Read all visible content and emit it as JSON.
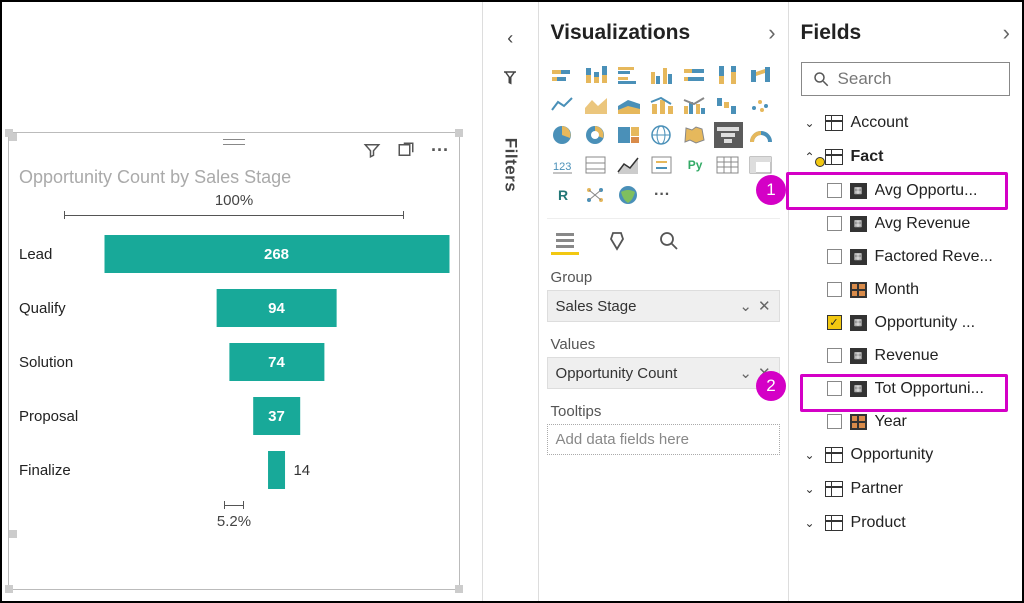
{
  "panes": {
    "visualizations_title": "Visualizations",
    "fields_title": "Fields",
    "filters_title": "Filters"
  },
  "search": {
    "placeholder": "Search"
  },
  "chart_data": {
    "type": "bar",
    "title": "Opportunity Count by Sales Stage",
    "top_pct": "100%",
    "bottom_pct": "5.2%",
    "categories": [
      "Lead",
      "Qualify",
      "Solution",
      "Proposal",
      "Finalize"
    ],
    "values": [
      268,
      94,
      74,
      37,
      14
    ]
  },
  "wells": {
    "group_label": "Group",
    "group_value": "Sales Stage",
    "values_label": "Values",
    "values_value": "Opportunity Count",
    "tooltips_label": "Tooltips",
    "tooltips_placeholder": "Add data fields here"
  },
  "viz_tiles": {
    "py": "Py",
    "r": "R",
    "more": "···"
  },
  "tree": {
    "account": "Account",
    "fact": "Fact",
    "fields": {
      "avg_opp": "Avg Opportu...",
      "avg_rev": "Avg Revenue",
      "fact_rev": "Factored Reve...",
      "month": "Month",
      "opp_count": "Opportunity ...",
      "revenue": "Revenue",
      "tot_opp": "Tot Opportuni...",
      "year": "Year"
    },
    "opportunity": "Opportunity",
    "partner": "Partner",
    "product": "Product"
  },
  "markers": {
    "m1": "1",
    "m2": "2"
  }
}
